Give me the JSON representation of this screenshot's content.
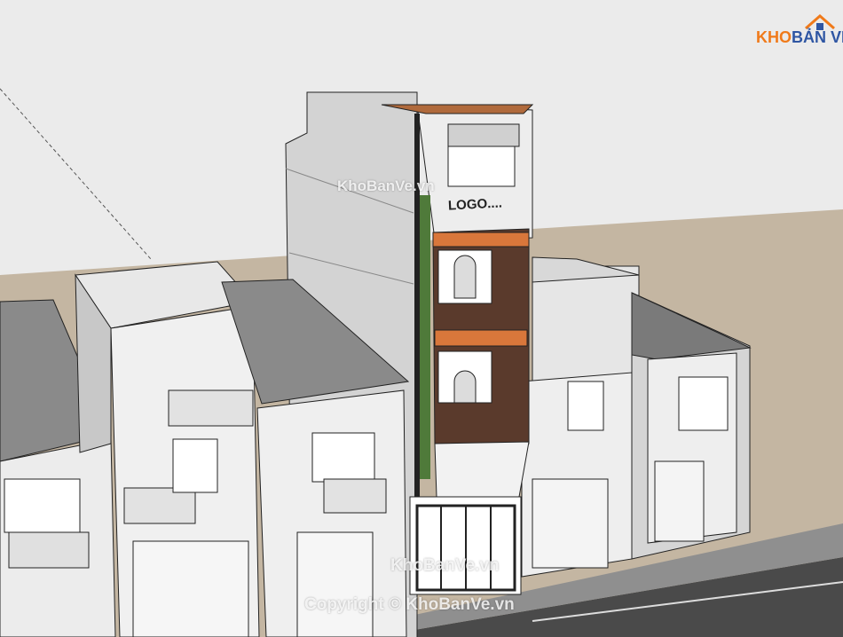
{
  "brand": {
    "part1": "KHO",
    "part2": "BẢN VẼ",
    "logo_icon": "house-roof-icon"
  },
  "watermarks": {
    "upper": "KhoBanVe.vn",
    "lower": "KhoBanVe.vn",
    "copyright": "Copyright © KhoBanVe.vn"
  },
  "facade": {
    "sign": "LOGO...."
  },
  "colors": {
    "sky": "#ebebeb",
    "ground": "#c4b6a2",
    "road": "#4a4a4a",
    "brick": "#5a3a2c",
    "accent_orange": "#d9773b",
    "wall": "#f0f0f0",
    "brand_orange": "#f07a1a",
    "brand_blue": "#2f56a3"
  }
}
